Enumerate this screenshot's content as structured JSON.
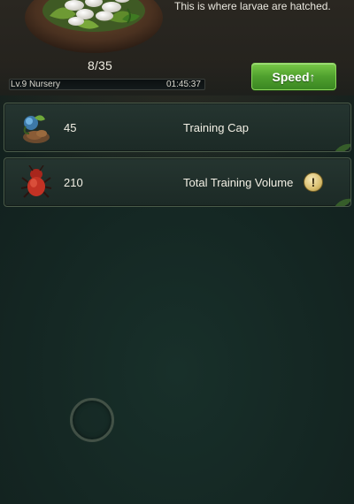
{
  "header": {
    "description": "This is where larvae are hatched.",
    "count": "8/35",
    "building": "Lv.9 Nursery",
    "timer": "01:45:37",
    "progress_fraction": 0,
    "speed_label": "Speed↑"
  },
  "stats": [
    {
      "value": "45",
      "label": "Training Cap",
      "icon": "larva-ant-icon"
    },
    {
      "value": "210",
      "label": "Total Training Volume",
      "icon": "red-ant-icon",
      "info_icon": "exclamation-icon"
    }
  ],
  "colors": {
    "accent_green": "#5aa834",
    "panel_border": "#4a5b49",
    "info_gold": "#d9be6e"
  }
}
